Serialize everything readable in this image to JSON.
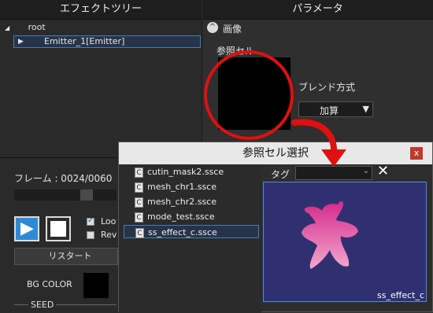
{
  "headers": {
    "effect_tree": "エフェクトツリー",
    "parameters": "パラメータ"
  },
  "tree": {
    "root_label": "root",
    "emitter_label": "Emitter_1[Emitter]"
  },
  "params": {
    "image_label": "画像",
    "ref_cell_label": "参照セル",
    "blend_label": "ブレンド方式",
    "blend_value": "加算"
  },
  "lower": {
    "frame_label": "フレーム : 0024/0060",
    "loop_label": "Loo",
    "reverse_label": "Rev",
    "restart_label": "リスタート",
    "bg_color_label": "BG COLOR",
    "seed_label": "SEED",
    "loop_checked": true,
    "reverse_checked": false
  },
  "dialog": {
    "title": "参照セル選択",
    "close_glyph": "x",
    "tag_label": "タグ",
    "tag_value": "",
    "files": [
      "cutin_mask2.ssce",
      "mesh_chr1.ssce",
      "mesh_chr2.ssce",
      "mode_test.ssce",
      "ss_effect_c.ssce"
    ],
    "selected_file": "ss_effect_c.ssce",
    "preview_caption": "ss_effect_c"
  },
  "colors": {
    "accent_red": "#e01010",
    "selection_border": "#4a78b8",
    "preview_bg": "#303070",
    "petal_pink": "#e8509a"
  }
}
